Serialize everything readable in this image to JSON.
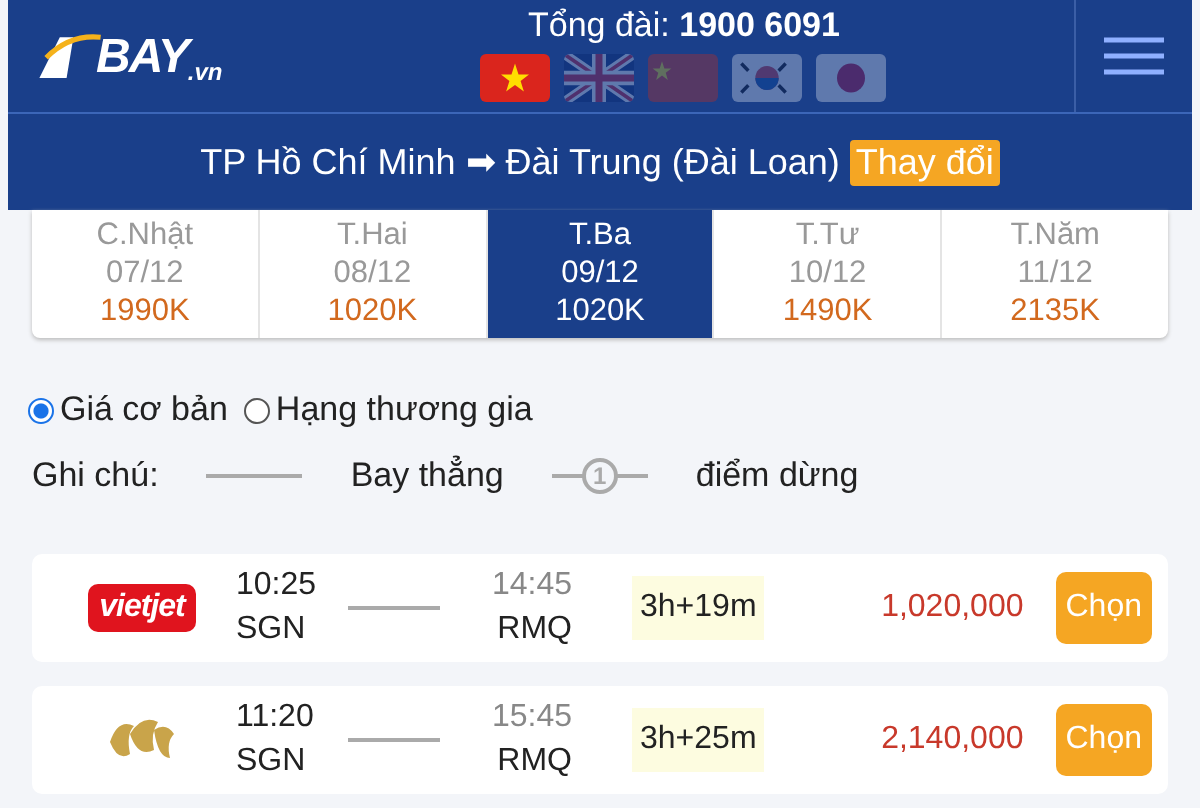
{
  "header": {
    "logo": "BAY",
    "logo_suffix": ".vn",
    "hotline_label": "Tổng đài:",
    "hotline_number": "1900 6091",
    "languages": [
      {
        "kind": "vn",
        "selected": true
      },
      {
        "kind": "uk",
        "selected": false
      },
      {
        "kind": "cn",
        "selected": false
      },
      {
        "kind": "kr",
        "selected": false
      },
      {
        "kind": "jp",
        "selected": false
      }
    ]
  },
  "route": {
    "from": "TP Hồ Chí Minh",
    "arrow": "➡",
    "to": "Đài Trung (Đài Loan)",
    "change": "Thay đổi"
  },
  "dates": [
    {
      "day": "C.Nhật",
      "date": "07/12",
      "price": "1990K",
      "selected": false
    },
    {
      "day": "T.Hai",
      "date": "08/12",
      "price": "1020K",
      "selected": false
    },
    {
      "day": "T.Ba",
      "date": "09/12",
      "price": "1020K",
      "selected": true
    },
    {
      "day": "T.Tư",
      "date": "10/12",
      "price": "1490K",
      "selected": false
    },
    {
      "day": "T.Năm",
      "date": "11/12",
      "price": "2135K",
      "selected": false
    }
  ],
  "fare_types": [
    {
      "label": "Giá cơ bản",
      "selected": true
    },
    {
      "label": "Hạng thương gia",
      "selected": false
    }
  ],
  "legend": {
    "label": "Ghi chú:",
    "direct": "Bay thẳng",
    "stop_count": "1",
    "stop": "điểm dừng"
  },
  "flights": [
    {
      "airline": {
        "kind": "vietjet",
        "text": "vietjet"
      },
      "depart_time": "10:25",
      "depart_code": "SGN",
      "arrive_time": "14:45",
      "arrive_code": "RMQ",
      "duration": "3h+19m",
      "price": "1,020,000",
      "button": "Chọn"
    },
    {
      "airline": {
        "kind": "bamboo"
      },
      "depart_time": "11:20",
      "depart_code": "SGN",
      "arrive_time": "15:45",
      "arrive_code": "RMQ",
      "duration": "3h+25m",
      "price": "2,140,000",
      "button": "Chọn"
    }
  ]
}
